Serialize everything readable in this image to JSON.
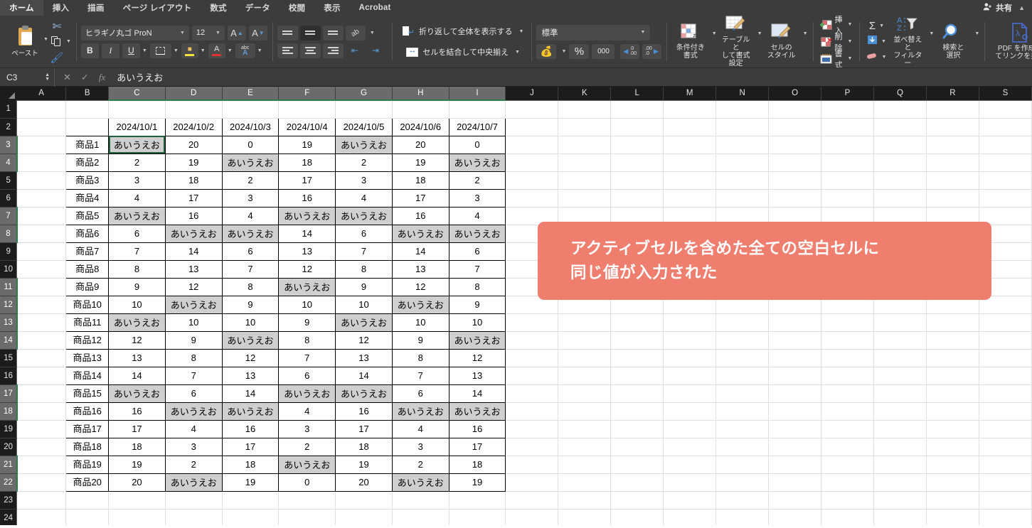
{
  "window": {
    "tabs": [
      {
        "label": "ホーム",
        "active": true
      },
      {
        "label": "挿入",
        "active": false
      },
      {
        "label": "描画",
        "active": false
      },
      {
        "label": "ページ レイアウト",
        "active": false
      },
      {
        "label": "数式",
        "active": false
      },
      {
        "label": "データ",
        "active": false
      },
      {
        "label": "校閲",
        "active": false
      },
      {
        "label": "表示",
        "active": false
      },
      {
        "label": "Acrobat",
        "active": false
      }
    ],
    "share_label": "共有",
    "share_icon": "person-plus-icon",
    "collapse_icon": "chevron-up-icon"
  },
  "ribbon": {
    "clipboard": {
      "paste_label": "ペースト",
      "paste_icon": "clipboard-icon",
      "cut_icon": "scissors-icon",
      "copy_icon": "copy-icon",
      "format_painter_icon": "paintbrush-icon"
    },
    "font": {
      "font_name": "ヒラギノ丸ゴ ProN",
      "font_size": "12",
      "grow_font_icon": "increase-font-size-icon",
      "shrink_font_icon": "decrease-font-size-icon",
      "bold_label": "B",
      "italic_label": "I",
      "underline_label": "U",
      "borders_icon": "borders-icon",
      "fill_color_icon": "fill-color-icon",
      "font_color_icon": "font-color-icon",
      "phonetic_top": "abc",
      "phonetic_bottom": "A"
    },
    "alignment": {
      "orientation_icon": "text-orientation-icon",
      "decrease_indent_icon": "decrease-indent-icon",
      "increase_indent_icon": "increase-indent-icon",
      "wrap_text_label": "折り返して全体を表示する",
      "wrap_text_icon": "wrap-text-icon",
      "merge_center_label": "セルを結合して中央揃え",
      "merge_center_icon": "merge-cells-icon"
    },
    "number": {
      "format_value": "標準",
      "currency_icon": "currency-icon",
      "percent_label": "%",
      "comma_label": "000",
      "increase_decimal_icon": "increase-decimal-icon",
      "decrease_decimal_icon": "decrease-decimal-icon"
    },
    "styles": {
      "conditional_format_label": "条件付き\n書式",
      "conditional_format_line1": "条件付き",
      "conditional_format_line2": "書式",
      "format_as_table_line1": "テーブルと",
      "format_as_table_line2": "して書式設定",
      "cell_styles_line1": "セルの",
      "cell_styles_line2": "スタイル"
    },
    "cells": {
      "insert_label": "挿入",
      "delete_label": "削除",
      "format_label": "書式",
      "insert_icon": "insert-cells-icon",
      "delete_icon": "delete-cells-icon",
      "format_icon": "format-cells-icon"
    },
    "editing": {
      "autosum_icon": "sigma-icon",
      "fill_icon": "fill-down-icon",
      "clear_icon": "eraser-icon",
      "sort_filter_line1": "並べ替えと",
      "sort_filter_line2": "フィルター",
      "sort_filter_icon": "sort-filter-icon",
      "find_select_line1": "検索と",
      "find_select_line2": "選択",
      "find_select_icon": "magnifier-icon"
    },
    "acrobat": {
      "pdf_line1": "PDF を作成し",
      "pdf_line2": "てリンクを共有",
      "pdf_icon": "pdf-icon"
    }
  },
  "formula_bar": {
    "name_box": "C3",
    "cancel_icon": "cancel-icon",
    "enter_icon": "check-icon",
    "function_icon": "fx-icon",
    "content": "あいうえお"
  },
  "grid": {
    "column_headers": [
      "A",
      "B",
      "C",
      "D",
      "E",
      "F",
      "G",
      "H",
      "I",
      "J",
      "K",
      "L",
      "M",
      "N",
      "O",
      "P",
      "Q",
      "R",
      "S"
    ],
    "selected_columns": [
      "C",
      "D",
      "E",
      "F",
      "G",
      "H",
      "I"
    ],
    "row_headers": [
      "1",
      "2",
      "3",
      "4",
      "5",
      "6",
      "7",
      "8",
      "9",
      "10",
      "11",
      "12",
      "13",
      "14",
      "15",
      "16",
      "17",
      "18",
      "19",
      "20",
      "21",
      "22",
      "23",
      "24"
    ],
    "highlighted_rows": [
      "3",
      "4",
      "7",
      "8",
      "11",
      "12",
      "13",
      "14",
      "17",
      "18",
      "21",
      "22"
    ],
    "active_cell": "C3",
    "fill_value": "あいうえお",
    "date_header_row": [
      "",
      "2024/10/1",
      "2024/10/2",
      "2024/10/3",
      "2024/10/4",
      "2024/10/5",
      "2024/10/6",
      "2024/10/7"
    ],
    "rows": [
      {
        "label": "商品1",
        "values": [
          "あいうえお",
          "20",
          "0",
          "19",
          "あいうえお",
          "20",
          "0"
        ]
      },
      {
        "label": "商品2",
        "values": [
          "2",
          "19",
          "あいうえお",
          "18",
          "2",
          "19",
          "あいうえお"
        ]
      },
      {
        "label": "商品3",
        "values": [
          "3",
          "18",
          "2",
          "17",
          "3",
          "18",
          "2"
        ]
      },
      {
        "label": "商品4",
        "values": [
          "4",
          "17",
          "3",
          "16",
          "4",
          "17",
          "3"
        ]
      },
      {
        "label": "商品5",
        "values": [
          "あいうえお",
          "16",
          "4",
          "あいうえお",
          "あいうえお",
          "16",
          "4"
        ]
      },
      {
        "label": "商品6",
        "values": [
          "6",
          "あいうえお",
          "あいうえお",
          "14",
          "6",
          "あいうえお",
          "あいうえお"
        ]
      },
      {
        "label": "商品7",
        "values": [
          "7",
          "14",
          "6",
          "13",
          "7",
          "14",
          "6"
        ]
      },
      {
        "label": "商品8",
        "values": [
          "8",
          "13",
          "7",
          "12",
          "8",
          "13",
          "7"
        ]
      },
      {
        "label": "商品9",
        "values": [
          "9",
          "12",
          "8",
          "あいうえお",
          "9",
          "12",
          "8"
        ]
      },
      {
        "label": "商品10",
        "values": [
          "10",
          "あいうえお",
          "9",
          "10",
          "10",
          "あいうえお",
          "9"
        ]
      },
      {
        "label": "商品11",
        "values": [
          "あいうえお",
          "10",
          "10",
          "9",
          "あいうえお",
          "10",
          "10"
        ]
      },
      {
        "label": "商品12",
        "values": [
          "12",
          "9",
          "あいうえお",
          "8",
          "12",
          "9",
          "あいうえお"
        ]
      },
      {
        "label": "商品13",
        "values": [
          "13",
          "8",
          "12",
          "7",
          "13",
          "8",
          "12"
        ]
      },
      {
        "label": "商品14",
        "values": [
          "14",
          "7",
          "13",
          "6",
          "14",
          "7",
          "13"
        ]
      },
      {
        "label": "商品15",
        "values": [
          "あいうえお",
          "6",
          "14",
          "あいうえお",
          "あいうえお",
          "6",
          "14"
        ]
      },
      {
        "label": "商品16",
        "values": [
          "16",
          "あいうえお",
          "あいうえお",
          "4",
          "16",
          "あいうえお",
          "あいうえお"
        ]
      },
      {
        "label": "商品17",
        "values": [
          "17",
          "4",
          "16",
          "3",
          "17",
          "4",
          "16"
        ]
      },
      {
        "label": "商品18",
        "values": [
          "18",
          "3",
          "17",
          "2",
          "18",
          "3",
          "17"
        ]
      },
      {
        "label": "商品19",
        "values": [
          "19",
          "2",
          "18",
          "あいうえお",
          "19",
          "2",
          "18"
        ]
      },
      {
        "label": "商品20",
        "values": [
          "20",
          "あいうえお",
          "19",
          "0",
          "20",
          "あいうえお",
          "19"
        ]
      }
    ]
  },
  "callout": {
    "line1": "アクティブセルを含めた全ての空白セルに",
    "line2": "同じ値が入力された",
    "color": "#ef7e6e"
  }
}
